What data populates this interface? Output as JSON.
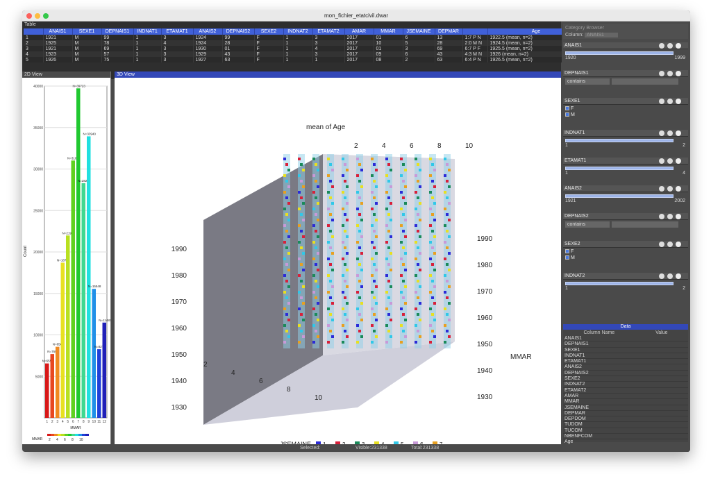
{
  "window": {
    "title": "mon_fichier_etatcivil.dwar"
  },
  "table": {
    "label": "Table",
    "columns": [
      "ANAIS1",
      "SEXE1",
      "DEPNAIS1",
      "INDNAT1",
      "ETAMAT1",
      "ANAIS2",
      "DEPNAIS2",
      "SEXE2",
      "INDNAT2",
      "ETAMAT2",
      "AMAR",
      "MMAR",
      "JSEMAINE",
      "DEPMAR",
      "",
      "Age"
    ],
    "rows": [
      [
        "1",
        "1921",
        "M",
        "99",
        "1",
        "3",
        "1924",
        "99",
        "F",
        "1",
        "3",
        "2017",
        "01",
        "6",
        "13",
        "1:7 P N",
        "1922.5 (mean, n=2)"
      ],
      [
        "2",
        "1925",
        "M",
        "78",
        "1",
        "4",
        "1924",
        "28",
        "F",
        "1",
        "3",
        "2017",
        "10",
        "5",
        "28",
        "2:0 M N",
        "1924.5 (mean, n=2)"
      ],
      [
        "3",
        "1921",
        "M",
        "69",
        "1",
        "3",
        "1930",
        "01",
        "F",
        "1",
        "4",
        "2017",
        "01",
        "3",
        "69",
        "6:7 P F",
        "1925.5 (mean, n=2)"
      ],
      [
        "4",
        "1923",
        "M",
        "57",
        "1",
        "3",
        "1929",
        "43",
        "F",
        "1",
        "3",
        "2017",
        "09",
        "6",
        "43",
        "4:3 M N",
        "1926 (mean, n=2)"
      ],
      [
        "5",
        "1926",
        "M",
        "75",
        "1",
        "3",
        "1927",
        "63",
        "F",
        "1",
        "1",
        "2017",
        "08",
        "2",
        "63",
        "6:4 P N",
        "1926.5 (mean, n=2)"
      ]
    ]
  },
  "view2d": {
    "label": "2D View",
    "axis_label_y": "Count",
    "axis_label_x": "MMAR",
    "legend_title": "MMAR",
    "legend_ticks": [
      "2",
      "4",
      "6",
      "8",
      "10"
    ],
    "yticks": [
      "5000",
      "10000",
      "15000",
      "20000",
      "25000",
      "30000",
      "35000",
      "40000"
    ]
  },
  "view3d": {
    "label": "3D View",
    "z_label": "mean of Age",
    "x_label": "MMAR",
    "z_ticks": [
      "1930",
      "1940",
      "1950",
      "1960",
      "1970",
      "1980",
      "1990"
    ],
    "x_ticks": [
      "2",
      "4",
      "6",
      "8",
      "10"
    ],
    "top_ticks": [
      "2",
      "4",
      "6",
      "8",
      "10"
    ],
    "legend_title": "JSEMAINE",
    "legend": [
      {
        "n": "1",
        "c": "#2b2bd8"
      },
      {
        "n": "2",
        "c": "#d8203a"
      },
      {
        "n": "3",
        "c": "#1a8a5a"
      },
      {
        "n": "4",
        "c": "#e8e020"
      },
      {
        "n": "5",
        "c": "#30c8e8"
      },
      {
        "n": "6",
        "c": "#c89ad8"
      },
      {
        "n": "7",
        "c": "#e8a020"
      }
    ]
  },
  "chart_data": {
    "type": "bar",
    "title": "",
    "xlabel": "MMAR",
    "ylabel": "Count",
    "categories": [
      "1",
      "2",
      "3",
      "4",
      "5",
      "6",
      "7",
      "8",
      "9",
      "10",
      "11",
      "12"
    ],
    "values": [
      6559,
      7691,
      8567,
      18707,
      21985,
      31023,
      39723,
      28293,
      33940,
      15548,
      8276,
      11485
    ],
    "labels": [
      "N=6559",
      "N=7691",
      "N=8567",
      "N=18707",
      "N=21985",
      "N=31023",
      "N=39723",
      "N=28293",
      "N=33940",
      "N=15548",
      "N=8276",
      "N=11485"
    ],
    "colors": [
      "#d81818",
      "#e84820",
      "#f08a20",
      "#e8e020",
      "#b8e020",
      "#60d020",
      "#20c830",
      "#40d890",
      "#20e0e0",
      "#2090e8",
      "#2040d8",
      "#2020b8"
    ],
    "ylim": [
      0,
      40000
    ]
  },
  "right": {
    "browser_title": "Category Browser",
    "column_label": "Column:",
    "column_value": "ANAIS1",
    "filters": [
      {
        "name": "ANAIS1",
        "type": "range",
        "lo": "1920",
        "hi": "1999"
      },
      {
        "name": "DEPNAIS1",
        "type": "text",
        "mode": "contains"
      },
      {
        "name": "SEXE1",
        "type": "check",
        "opts": [
          "F",
          "M"
        ]
      },
      {
        "name": "INDNAT1",
        "type": "range",
        "lo": "1",
        "hi": "2"
      },
      {
        "name": "ETAMAT1",
        "type": "range",
        "lo": "1",
        "hi": "4"
      },
      {
        "name": "ANAIS2",
        "type": "range",
        "lo": "1921",
        "hi": "2002"
      },
      {
        "name": "DEPNAIS2",
        "type": "text",
        "mode": "contains"
      },
      {
        "name": "SEXE2",
        "type": "check",
        "opts": [
          "F",
          "M"
        ]
      },
      {
        "name": "INDNAT2",
        "type": "range",
        "lo": "1",
        "hi": "2"
      }
    ],
    "data_title": "Data",
    "data_headers": [
      "Column Name",
      "Value"
    ],
    "data_rows": [
      "ANAIS1",
      "DEPNAIS1",
      "SEXE1",
      "INDNAT1",
      "ETAMAT1",
      "ANAIS2",
      "DEPNAIS2",
      "SEXE2",
      "INDNAT2",
      "ETAMAT2",
      "AMAR",
      "MMAR",
      "JSEMAINE",
      "DEPMAR",
      "DEPDOM",
      "TUDOM",
      "TUCOM",
      "NBENFCOM",
      "Age"
    ]
  },
  "status": {
    "selected": "Selected:",
    "visible": "Visible:231338",
    "total": "Total:231338"
  }
}
